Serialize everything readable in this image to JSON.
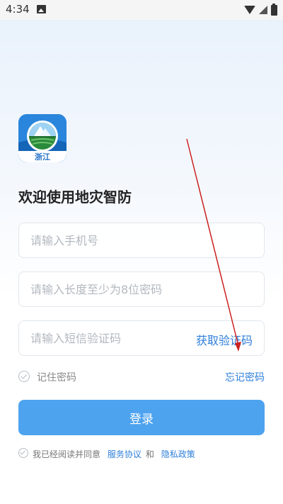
{
  "status_bar": {
    "time": "4:34"
  },
  "logo": {
    "text": "浙江"
  },
  "welcome_title": "欢迎使用地灾智防",
  "phone_field": {
    "placeholder": "请输入手机号"
  },
  "password_field": {
    "placeholder": "请输入长度至少为8位密码"
  },
  "sms_field": {
    "placeholder": "请输入短信验证码"
  },
  "get_code_label": "获取验证码",
  "remember_label": "记住密码",
  "forgot_label": "忘记密码",
  "login_label": "登录",
  "agreement": {
    "prefix": "我已经阅读并同意",
    "service_link": "服务协议",
    "and": "和",
    "privacy_link": "隐私政策"
  },
  "colors": {
    "accent": "#2f7fd9",
    "button": "#4ea3ef",
    "annotation_arrow": "#cc2222"
  }
}
